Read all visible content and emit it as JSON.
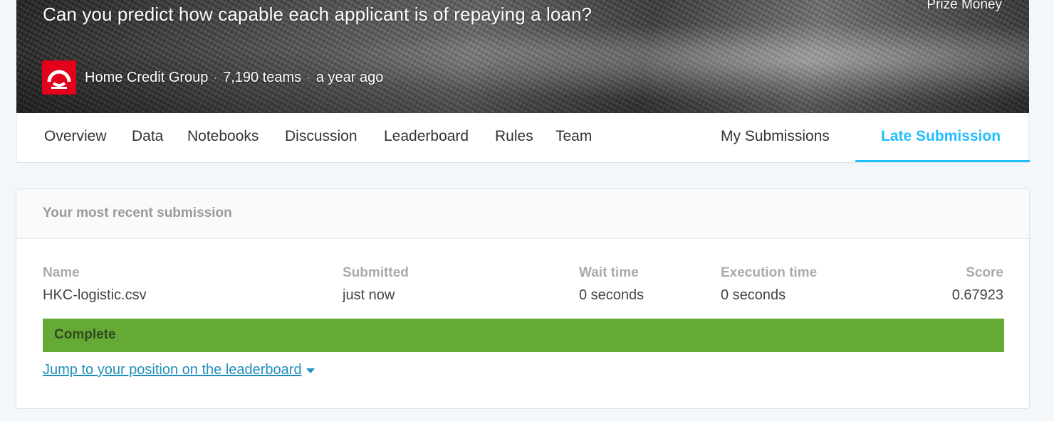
{
  "banner": {
    "title": "Can you predict how capable each applicant is of repaying a loan?",
    "prize_label": "Prize Money",
    "host_name": "Home Credit Group",
    "teams": "7,190 teams",
    "time_ago": "a year ago",
    "separator": "·",
    "logo_icon": "home-credit-logo",
    "logo_color": "#e2001a"
  },
  "tabs": [
    {
      "label": "Overview"
    },
    {
      "label": "Data"
    },
    {
      "label": "Notebooks"
    },
    {
      "label": "Discussion"
    },
    {
      "label": "Leaderboard"
    },
    {
      "label": "Rules"
    },
    {
      "label": "Team"
    },
    {
      "label": "My Submissions"
    },
    {
      "label": "Late Submission",
      "active": true
    }
  ],
  "accent_color": "#20beff",
  "submission": {
    "header": "Your most recent submission",
    "columns": {
      "name": {
        "label": "Name",
        "value": "HKC-logistic.csv"
      },
      "submitted": {
        "label": "Submitted",
        "value": "just now"
      },
      "wait_time": {
        "label": "Wait time",
        "value": "0 seconds"
      },
      "execution_time": {
        "label": "Execution time",
        "value": "0 seconds"
      },
      "score": {
        "label": "Score",
        "value": "0.67923"
      }
    },
    "status": "Complete",
    "status_color": "#66aa36",
    "jump_link": "Jump to your position on the leaderboard",
    "jump_icon": "caret-down-icon"
  }
}
